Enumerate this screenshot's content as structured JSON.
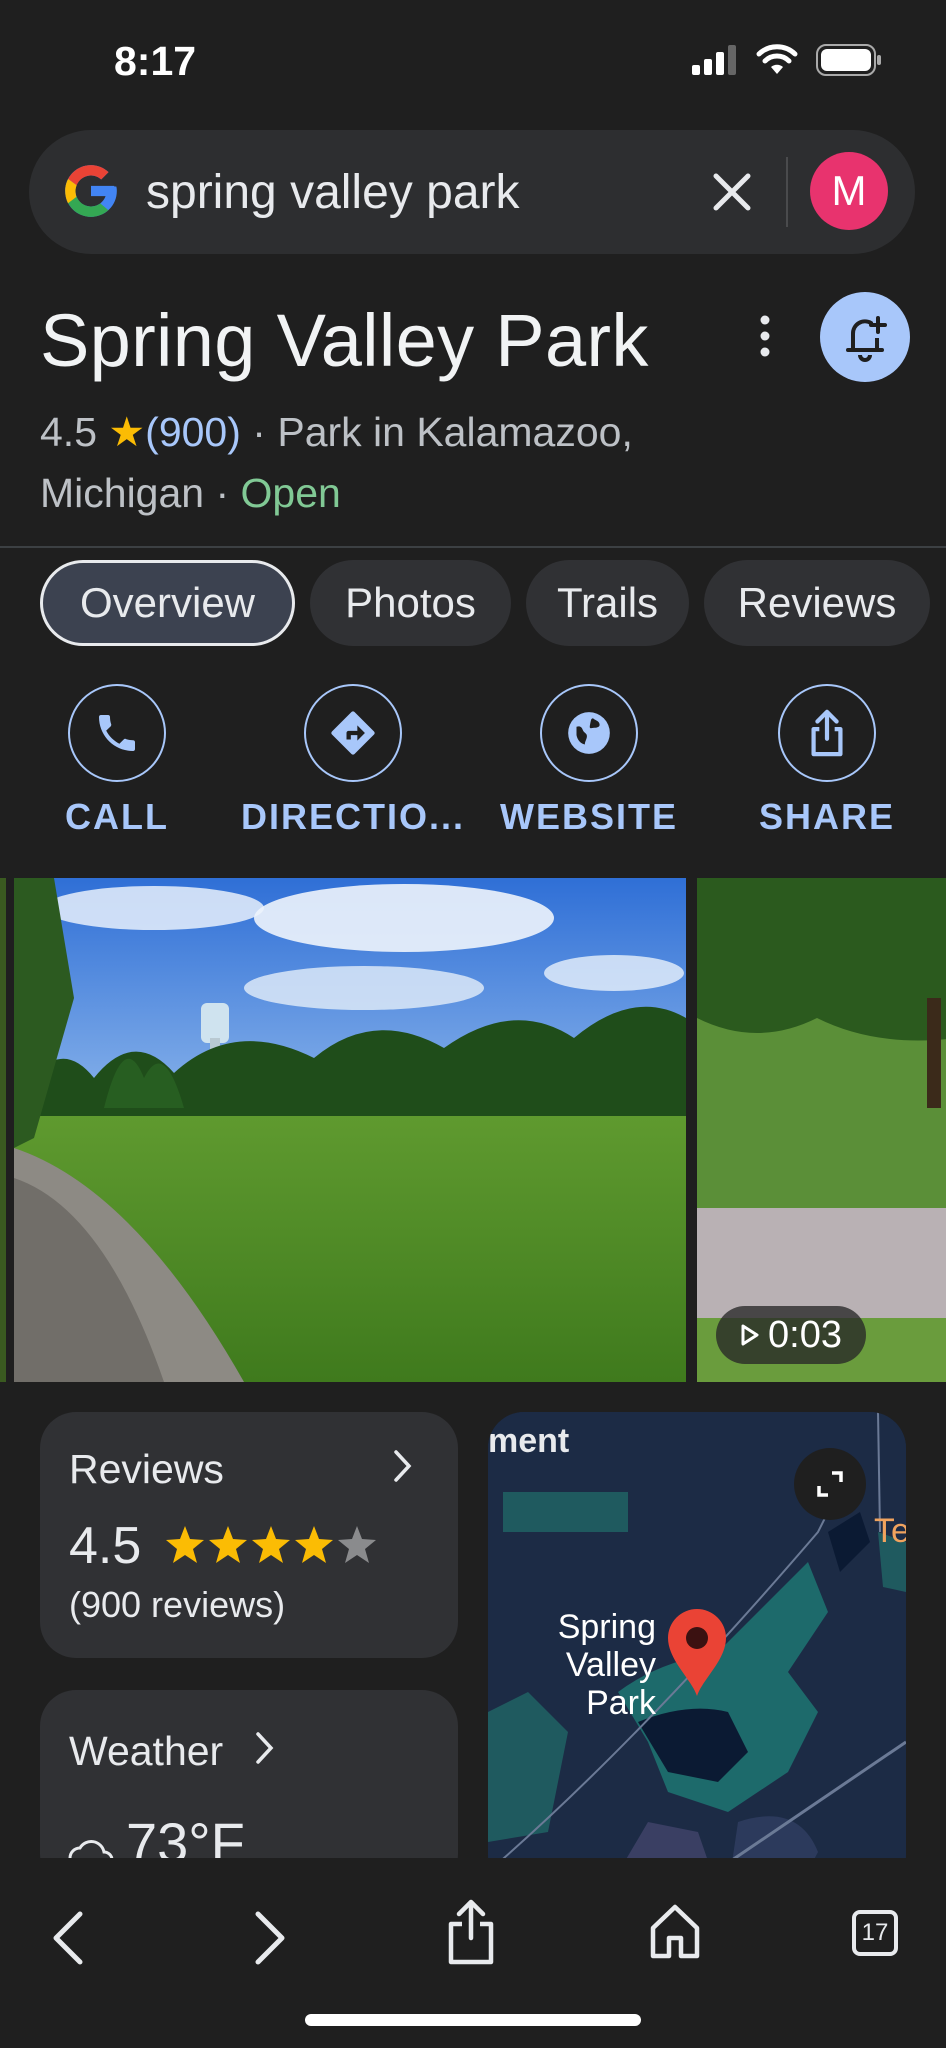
{
  "status_bar": {
    "time": "8:17"
  },
  "search": {
    "query": "spring valley park",
    "avatar_letter": "M"
  },
  "place": {
    "title": "Spring Valley Park",
    "rating": "4.5",
    "rating_count": "(900)",
    "category_line_1": "· Park in Kalamazoo,",
    "category_line_2": "Michigan ·",
    "status": "Open"
  },
  "tabs": [
    "Overview",
    "Photos",
    "Trails",
    "Reviews"
  ],
  "actions": [
    "CALL",
    "DIRECTIO...",
    "WEBSITE",
    "SHARE"
  ],
  "video": {
    "duration": "0:03"
  },
  "reviews_card": {
    "title": "Reviews",
    "rating": "4.5",
    "stars": 4.5,
    "count": "(900 reviews)"
  },
  "weather_card": {
    "title": "Weather",
    "temperature": "73°F"
  },
  "map": {
    "label_partial_left": "ment",
    "label_partial_right": "Te",
    "pin_label_line1": "Spring",
    "pin_label_line2": "Valley Park"
  },
  "bottom_bar": {
    "tabs_count": "17"
  },
  "colors": {
    "accent": "#a8c7fa",
    "open": "#81c995",
    "star": "#fbbc04",
    "pin": "#ea4335",
    "avatar": "#e8336e"
  }
}
